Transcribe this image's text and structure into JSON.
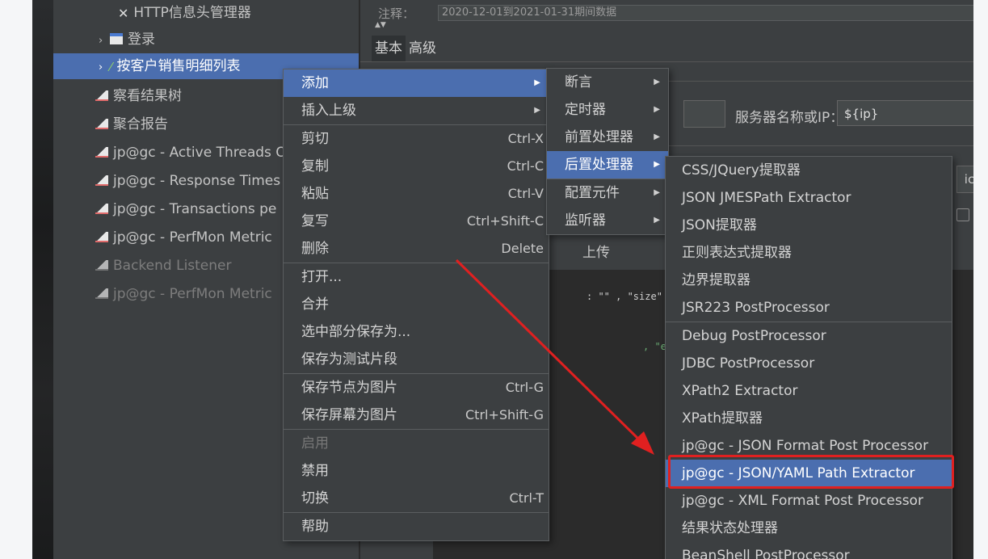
{
  "tree": {
    "items": [
      {
        "label": "HTTP信息头管理器",
        "icon": "wrench-icon"
      },
      {
        "label": "登录",
        "icon": "controller-icon"
      },
      {
        "label": "按客户销售明细列表",
        "icon": "sampler-pen-icon"
      },
      {
        "label": "察看结果树",
        "icon": "listener-icon"
      },
      {
        "label": "聚合报告",
        "icon": "listener-icon"
      },
      {
        "label": "jp@gc - Active Threads O",
        "icon": "listener-icon"
      },
      {
        "label": "jp@gc - Response Times",
        "icon": "listener-icon"
      },
      {
        "label": "jp@gc - Transactions pe",
        "icon": "listener-icon"
      },
      {
        "label": "jp@gc - PerfMon Metric",
        "icon": "listener-icon"
      },
      {
        "label": "Backend Listener",
        "icon": "listener-icon"
      },
      {
        "label": "jp@gc - PerfMon Metric",
        "icon": "listener-icon"
      }
    ]
  },
  "panel": {
    "comment_label": "注释：",
    "comment_value": "2020-12-01到2021-01-31期间数据",
    "tabs": [
      "基本",
      "高级"
    ],
    "server_label": "服务器名称或IP：",
    "server_value": "${ip}",
    "upload_label": "上传",
    "code_a": ": \"\"  , \"size\"",
    "code_b": ", \"endT",
    "code_c": ",",
    "truncated_ic": "ic"
  },
  "context_menu": {
    "items": [
      {
        "label": "添加",
        "shortcut": "",
        "submenu": true
      },
      {
        "label": "插入上级",
        "shortcut": "",
        "submenu": true
      },
      {
        "label": "剪切",
        "shortcut": "Ctrl-X"
      },
      {
        "label": "复制",
        "shortcut": "Ctrl-C"
      },
      {
        "label": "粘贴",
        "shortcut": "Ctrl-V"
      },
      {
        "label": "复写",
        "shortcut": "Ctrl+Shift-C"
      },
      {
        "label": "删除",
        "shortcut": "Delete"
      },
      {
        "label": "打开..."
      },
      {
        "label": "合并"
      },
      {
        "label": "选中部分保存为..."
      },
      {
        "label": "保存为测试片段"
      },
      {
        "label": "保存节点为图片",
        "shortcut": "Ctrl-G"
      },
      {
        "label": "保存屏幕为图片",
        "shortcut": "Ctrl+Shift-G"
      },
      {
        "label": "启用"
      },
      {
        "label": "禁用"
      },
      {
        "label": "切换",
        "shortcut": "Ctrl-T"
      },
      {
        "label": "帮助"
      }
    ]
  },
  "add_submenu": {
    "items": [
      "断言",
      "定时器",
      "前置处理器",
      "后置处理器",
      "配置元件",
      "监听器"
    ]
  },
  "post_submenu": {
    "items": [
      "CSS/JQuery提取器",
      "JSON JMESPath Extractor",
      "JSON提取器",
      "正则表达式提取器",
      "边界提取器",
      "JSR223 PostProcessor",
      "Debug PostProcessor",
      "JDBC PostProcessor",
      "XPath2 Extractor",
      "XPath提取器",
      "jp@gc - JSON Format Post Processor",
      "jp@gc - JSON/YAML Path Extractor",
      "jp@gc - XML Format Post Processor",
      "结果状态处理器",
      "BeanShell PostProcessor"
    ]
  },
  "colors": {
    "highlight": "#4b6eaf",
    "annotation": "#e02020",
    "menu_bg": "#3c3f41"
  }
}
